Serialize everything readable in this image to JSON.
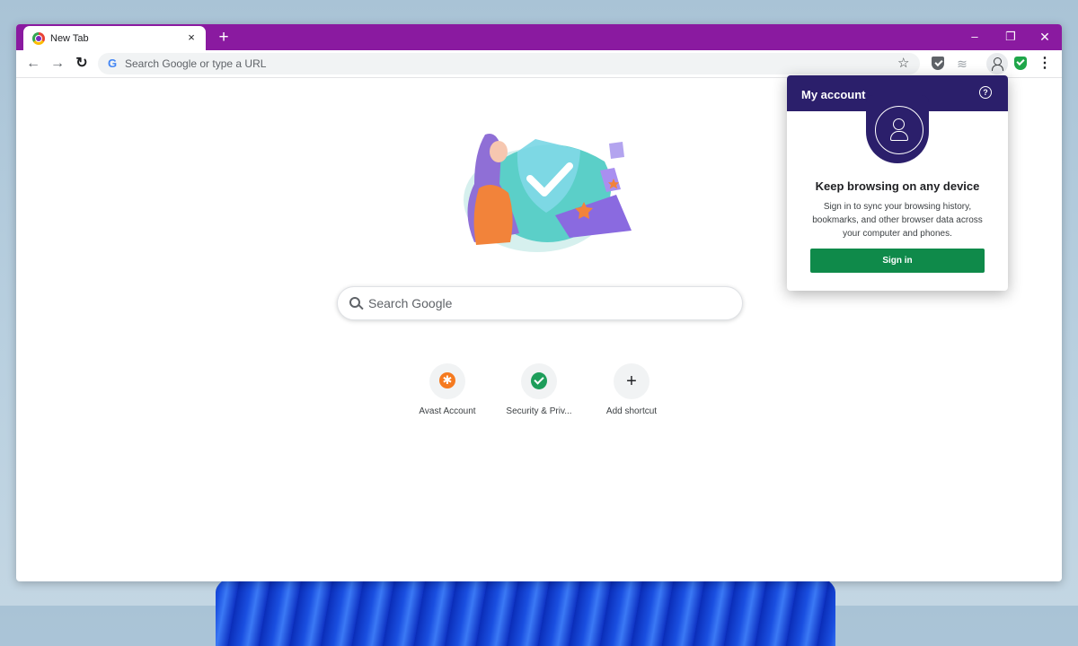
{
  "tab": {
    "title": "New Tab",
    "close_icon": "×"
  },
  "tabstrip": {
    "new_tab_icon": "+",
    "minimize_icon": "–",
    "restore_icon": "❐",
    "close_icon": "✕"
  },
  "toolbar": {
    "back_icon": "←",
    "forward_icon": "→",
    "reload_icon": "↻",
    "omnibox_placeholder": "Search Google or type a URL",
    "bookmark_icon": "☆",
    "menu_icon": "⋮"
  },
  "search": {
    "placeholder": "Search Google"
  },
  "shortcuts": [
    {
      "label": "Avast Account",
      "icon": "avast-logo-icon"
    },
    {
      "label": "Security & Priv...",
      "icon": "shield-check-icon"
    },
    {
      "label": "Add shortcut",
      "icon": "plus-icon",
      "glyph": "+"
    }
  ],
  "account_popup": {
    "title": "My account",
    "help_glyph": "?",
    "heading": "Keep browsing on any device",
    "description": "Sign in to sync your browsing history, bookmarks, and other browser data across your computer and phones.",
    "signin_label": "Sign in"
  },
  "colors": {
    "tabstrip": "#8a1aa0",
    "popup_header": "#2b1f6b",
    "signin_button": "#0f8a4a",
    "avast_orange": "#f57a1f",
    "shield_green": "#1d9d5a"
  }
}
